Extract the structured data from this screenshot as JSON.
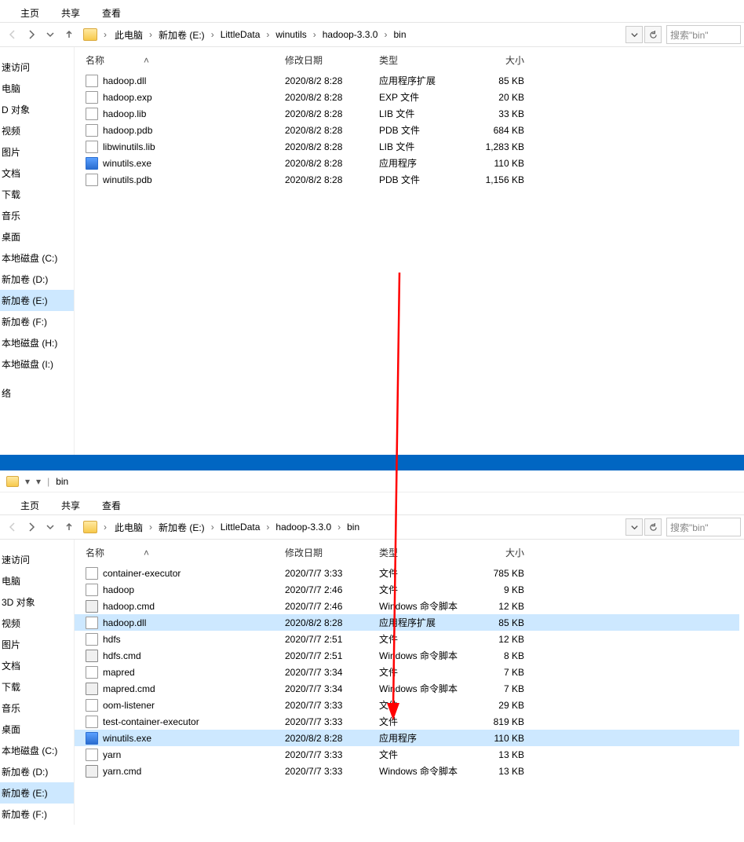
{
  "tabs": {
    "home": "主页",
    "share": "共享",
    "view": "查看"
  },
  "top": {
    "crumbs": [
      "此电脑",
      "新加卷 (E:)",
      "LittleData",
      "winutils",
      "hadoop-3.3.0",
      "bin"
    ],
    "search_placeholder": "搜索\"bin\"",
    "cols": {
      "name": "名称",
      "date": "修改日期",
      "type": "类型",
      "size": "大小"
    },
    "sidebar": [
      {
        "label": "速访问"
      },
      {
        "label": "电脑"
      },
      {
        "label": "D 对象"
      },
      {
        "label": "视频"
      },
      {
        "label": "图片"
      },
      {
        "label": "文档"
      },
      {
        "label": "下载"
      },
      {
        "label": "音乐"
      },
      {
        "label": "桌面"
      },
      {
        "label": "本地磁盘 (C:)"
      },
      {
        "label": "新加卷 (D:)"
      },
      {
        "label": "新加卷 (E:)",
        "selected": true
      },
      {
        "label": "新加卷 (F:)"
      },
      {
        "label": "本地磁盘 (H:)"
      },
      {
        "label": "本地磁盘 (I:)"
      },
      {
        "label": ""
      },
      {
        "label": "络"
      }
    ],
    "rows": [
      {
        "icon": "dll",
        "name": "hadoop.dll",
        "date": "2020/8/2 8:28",
        "type": "应用程序扩展",
        "size": "85 KB"
      },
      {
        "icon": "file",
        "name": "hadoop.exp",
        "date": "2020/8/2 8:28",
        "type": "EXP 文件",
        "size": "20 KB"
      },
      {
        "icon": "file",
        "name": "hadoop.lib",
        "date": "2020/8/2 8:28",
        "type": "LIB 文件",
        "size": "33 KB"
      },
      {
        "icon": "file",
        "name": "hadoop.pdb",
        "date": "2020/8/2 8:28",
        "type": "PDB 文件",
        "size": "684 KB"
      },
      {
        "icon": "file",
        "name": "libwinutils.lib",
        "date": "2020/8/2 8:28",
        "type": "LIB 文件",
        "size": "1,283 KB"
      },
      {
        "icon": "exe",
        "name": "winutils.exe",
        "date": "2020/8/2 8:28",
        "type": "应用程序",
        "size": "110 KB"
      },
      {
        "icon": "file",
        "name": "winutils.pdb",
        "date": "2020/8/2 8:28",
        "type": "PDB 文件",
        "size": "1,156 KB"
      }
    ]
  },
  "bottom": {
    "title": "bin",
    "crumbs": [
      "此电脑",
      "新加卷 (E:)",
      "LittleData",
      "hadoop-3.3.0",
      "bin"
    ],
    "search_placeholder": "搜索\"bin\"",
    "cols": {
      "name": "名称",
      "date": "修改日期",
      "type": "类型",
      "size": "大小"
    },
    "sidebar": [
      {
        "label": "速访问"
      },
      {
        "label": "电脑"
      },
      {
        "label": "3D 对象"
      },
      {
        "label": "视频"
      },
      {
        "label": "图片"
      },
      {
        "label": "文档"
      },
      {
        "label": "下载"
      },
      {
        "label": "音乐"
      },
      {
        "label": "桌面"
      },
      {
        "label": "本地磁盘 (C:)"
      },
      {
        "label": "新加卷 (D:)"
      },
      {
        "label": "新加卷 (E:)",
        "selected": true
      },
      {
        "label": "新加卷 (F:)"
      }
    ],
    "rows": [
      {
        "icon": "file",
        "name": "container-executor",
        "date": "2020/7/7 3:33",
        "type": "文件",
        "size": "785 KB"
      },
      {
        "icon": "file",
        "name": "hadoop",
        "date": "2020/7/7 2:46",
        "type": "文件",
        "size": "9 KB"
      },
      {
        "icon": "cmd",
        "name": "hadoop.cmd",
        "date": "2020/7/7 2:46",
        "type": "Windows 命令脚本",
        "size": "12 KB"
      },
      {
        "icon": "dll",
        "name": "hadoop.dll",
        "date": "2020/8/2 8:28",
        "type": "应用程序扩展",
        "size": "85 KB",
        "selected": true
      },
      {
        "icon": "file",
        "name": "hdfs",
        "date": "2020/7/7 2:51",
        "type": "文件",
        "size": "12 KB"
      },
      {
        "icon": "cmd",
        "name": "hdfs.cmd",
        "date": "2020/7/7 2:51",
        "type": "Windows 命令脚本",
        "size": "8 KB"
      },
      {
        "icon": "file",
        "name": "mapred",
        "date": "2020/7/7 3:34",
        "type": "文件",
        "size": "7 KB"
      },
      {
        "icon": "cmd",
        "name": "mapred.cmd",
        "date": "2020/7/7 3:34",
        "type": "Windows 命令脚本",
        "size": "7 KB"
      },
      {
        "icon": "file",
        "name": "oom-listener",
        "date": "2020/7/7 3:33",
        "type": "文件",
        "size": "29 KB"
      },
      {
        "icon": "file",
        "name": "test-container-executor",
        "date": "2020/7/7 3:33",
        "type": "文件",
        "size": "819 KB"
      },
      {
        "icon": "exe",
        "name": "winutils.exe",
        "date": "2020/8/2 8:28",
        "type": "应用程序",
        "size": "110 KB",
        "selected": true
      },
      {
        "icon": "file",
        "name": "yarn",
        "date": "2020/7/7 3:33",
        "type": "文件",
        "size": "13 KB"
      },
      {
        "icon": "cmd",
        "name": "yarn.cmd",
        "date": "2020/7/7 3:33",
        "type": "Windows 命令脚本",
        "size": "13 KB"
      }
    ]
  }
}
